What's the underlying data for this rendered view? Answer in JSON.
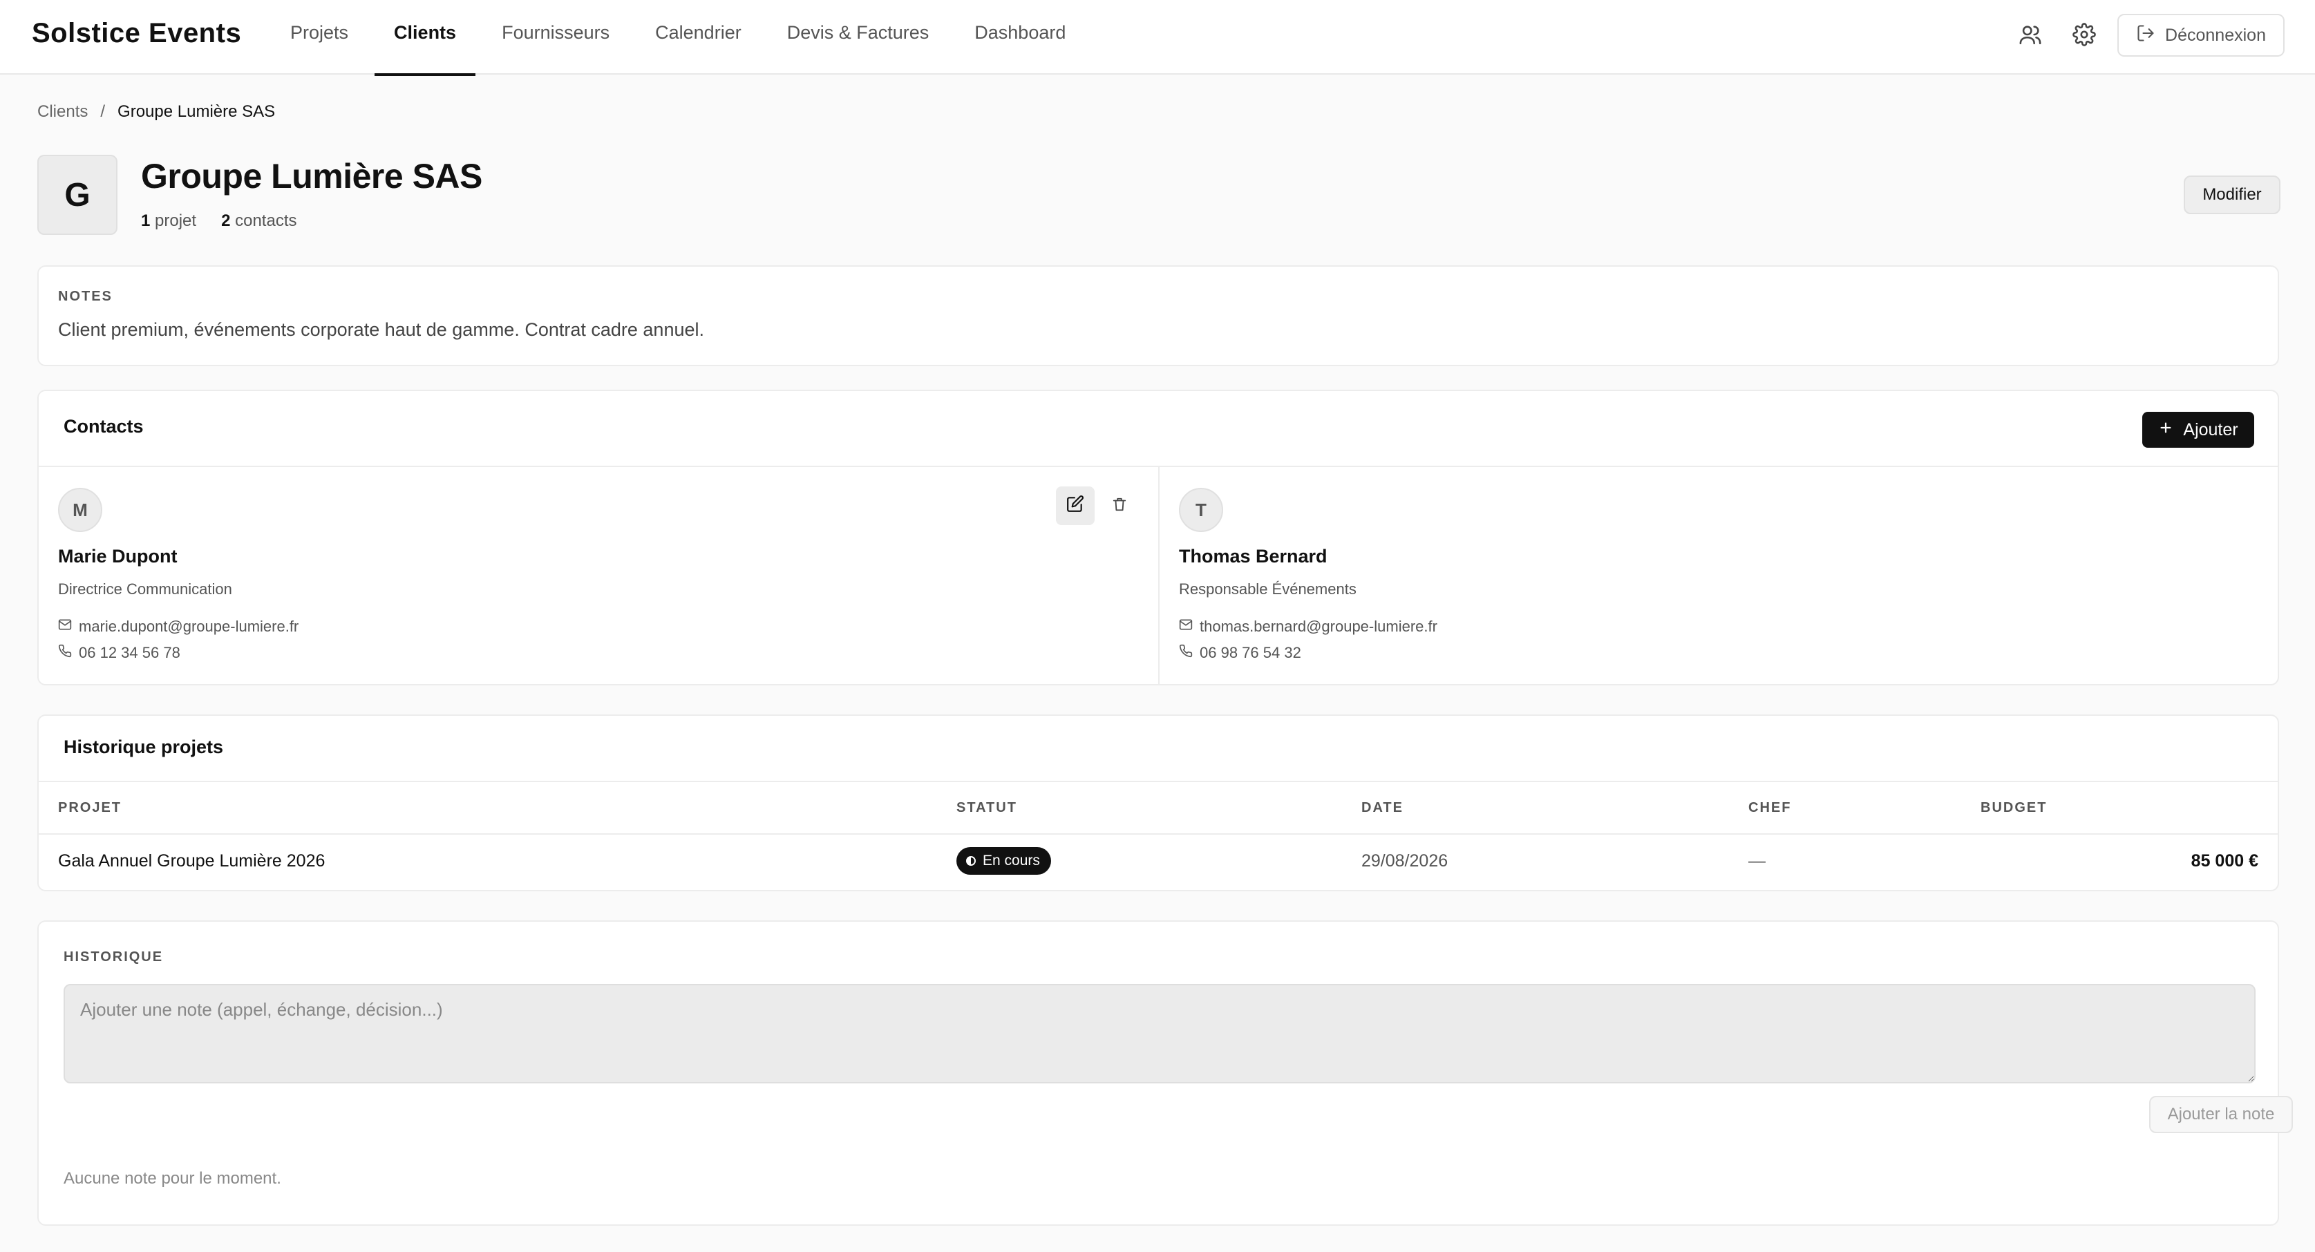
{
  "header": {
    "brand": "Solstice Events",
    "nav": [
      "Projets",
      "Clients",
      "Fournisseurs",
      "Calendrier",
      "Devis & Factures",
      "Dashboard"
    ],
    "active_tab": "Clients",
    "logout_label": "Déconnexion",
    "icons": [
      "users-icon",
      "gear-icon",
      "logout-icon"
    ]
  },
  "breadcrumb": {
    "parent": "Clients",
    "separator": "/",
    "current": "Groupe Lumière SAS"
  },
  "client": {
    "initial": "G",
    "name": "Groupe Lumière SAS",
    "projects_count": "1",
    "projects_label": "projet",
    "contacts_count": "2",
    "contacts_label": "contacts",
    "modify_label": "Modifier"
  },
  "notes": {
    "label": "NOTES",
    "text": "Client premium, événements corporate haut de gamme. Contrat cadre annuel."
  },
  "contacts": {
    "title": "Contacts",
    "add_label": "Ajouter",
    "items": [
      {
        "initial": "M",
        "name": "Marie Dupont",
        "role": "Directrice Communication",
        "email": "marie.dupont@groupe-lumiere.fr",
        "phone": "06 12 34 56 78"
      },
      {
        "initial": "T",
        "name": "Thomas Bernard",
        "role": "Responsable Événements",
        "email": "thomas.bernard@groupe-lumiere.fr",
        "phone": "06 98 76 54 32"
      }
    ]
  },
  "projects": {
    "title": "Historique projets",
    "columns": [
      "PROJET",
      "STATUT",
      "DATE",
      "CHEF",
      "BUDGET"
    ],
    "rows": [
      {
        "name": "Gala Annuel Groupe Lumière 2026",
        "status": "En cours",
        "date": "29/08/2026",
        "chef": "—",
        "budget": "85 000 €"
      }
    ]
  },
  "history": {
    "label": "HISTORIQUE",
    "placeholder": "Ajouter une note (appel, échange, décision...)",
    "add_note_label": "Ajouter la note",
    "empty_text": "Aucune note pour le moment."
  },
  "colors": {
    "accent": "#111111",
    "background": "#fafafa",
    "card": "#ffffff",
    "border": "#ececec"
  }
}
